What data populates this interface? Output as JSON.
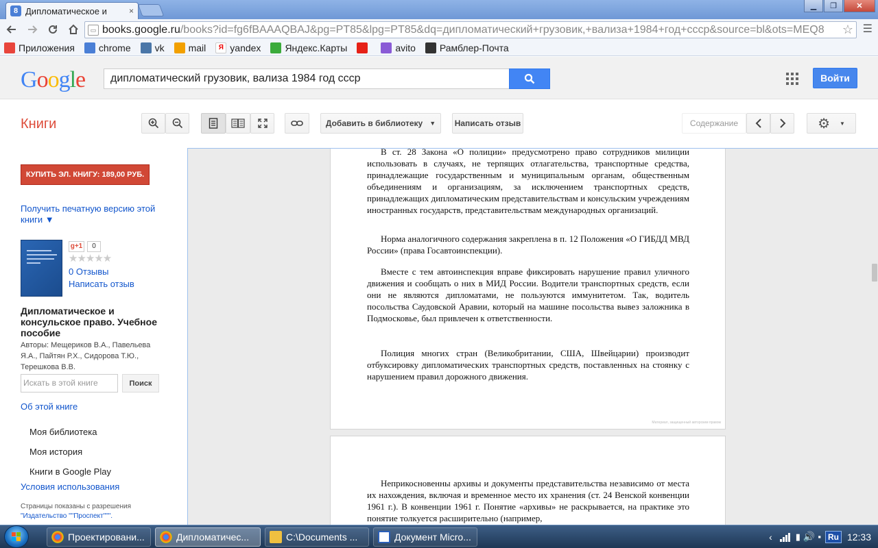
{
  "browser": {
    "tab_title": "Дипломатическое и",
    "tab_favicon": "8",
    "tab_close": "×",
    "url_host": "books.google.ru",
    "url_rest": "/books?id=fg6fBAAAQBAJ&pg=PT85&lpg=PT85&dq=дипломатический+грузовик,+вализа+1984+год+ссср&source=bl&ots=MEQ8",
    "window_buttons": [
      "▁",
      "❐",
      "✕"
    ],
    "bookmarks": [
      {
        "label": "Приложения",
        "icon": "apps-icon",
        "color": "#e8453c"
      },
      {
        "label": "chrome",
        "icon": "google-icon",
        "color": "#4a7fd6"
      },
      {
        "label": "vk",
        "icon": "vk-icon",
        "color": "#4a76a8"
      },
      {
        "label": "mail",
        "icon": "mail-icon",
        "color": "#f2a000"
      },
      {
        "label": "yandex",
        "icon": "yandex-icon",
        "color": "#ffffff"
      },
      {
        "label": "Яндекс.Карты",
        "icon": "maps-icon",
        "color": "#3bab3b"
      },
      {
        "label": "",
        "icon": "youtube-icon",
        "color": "#e62117"
      },
      {
        "label": "avito",
        "icon": "avito-icon",
        "color": "#8a5bd6"
      },
      {
        "label": "Рамблер-Почта",
        "icon": "rambler-icon",
        "color": "#333333"
      }
    ]
  },
  "google": {
    "logo": "Google",
    "search_value": "дипломатический грузовик, вализа 1984 год ссср",
    "signin_label": "Войти"
  },
  "books_toolbar": {
    "title": "Книги",
    "add_library": "Добавить в библиотеку",
    "write_review": "Написать отзыв",
    "contents": "Содержание"
  },
  "sidebar": {
    "buy_label": "КУПИТЬ ЭЛ. КНИГУ: 189,00 РУБ.",
    "print_version": "Получить печатную версию этой книги ▼",
    "gplus": "g+1",
    "gplus_count": "0",
    "stars": "★★★★★",
    "reviews": "0 Отзывы",
    "write_review": "Написать отзыв",
    "book_title": "Дипломатическое и консульское право. Учебное пособие",
    "authors": "Авторы: Мещериков В.А., Павельева Я.А., Пайтян Р.Х., Сидорова Т.Ю., Терешкова В.В.",
    "search_placeholder": "Искать в этой книге",
    "search_btn": "Поиск",
    "about": "Об этой книге",
    "my_library": "Моя библиотека",
    "my_history": "Моя история",
    "books_play": "Книги в Google Play",
    "terms": "Условия использования",
    "perm_prefix": "Страницы показаны с разрешения",
    "perm_publisher": "\"Издательство \"\"Проспект\"\"\"."
  },
  "reader": {
    "page1": {
      "p0": "В ст. 28 Закона «О полиции» предусмотрено право сотрудников милиции использовать в случаях, не терпящих отлагательства, транспортные средства, принадлежащие государственным и муниципальным органам, общественным объединениям и организациям, за исключением транспортных средств, принадлежащих дипломатическим представительствам и консульским учреждениям иностранных государств, представительствам международных организаций.",
      "p1": "Норма аналогичного содержания закреплена в п. 12 Положения «О ГИБДД МВД России» (права Госавтоинспекции).",
      "p2": "Вместе с тем автоинспекция вправе фиксировать нарушение правил уличного движения и сообщать о них в МИД России. Водители транспортных средств, если они не являются дипломатами, не пользуются иммунитетом. Так, водитель посольства Саудовской Аравии, который на машине посольства вывез заложника в Подмосковье, был привлечен к ответственности.",
      "p3": "Полиция многих стран (Великобритании, США, Швейцарии) производит отбуксировку дипломатических транспортных средств, поставленных на стоянку с нарушением правил дорожного движения.",
      "watermark": "Материал, защищенный авторским правом"
    },
    "page2": {
      "p0": "Неприкосновенны архивы и документы представительства независимо от места их нахождения, включая и временное место их хранения (ст. 24 Венской конвенции 1961 г.). В конвенции 1961 г. Понятие «архивы» не раскрывается, на практике это понятие толкуется расширительно (например,"
    }
  },
  "taskbar": {
    "items": [
      {
        "label": "Проектировани...",
        "color": "#e8453c"
      },
      {
        "label": "Дипломатичес...",
        "color": "#e8453c"
      },
      {
        "label": "C:\\Documents ...",
        "color": "#f0c040"
      },
      {
        "label": "Документ Micro...",
        "color": "#2b5fb8"
      }
    ],
    "lang": "Ru",
    "clock": "12:33"
  }
}
